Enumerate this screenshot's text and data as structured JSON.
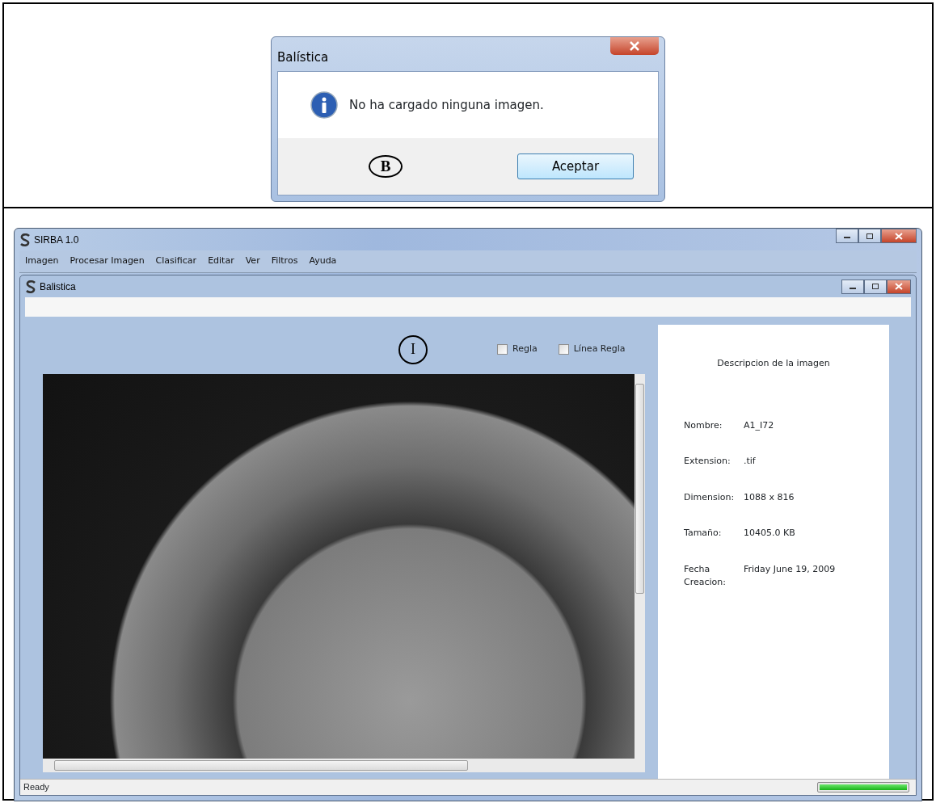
{
  "dialog": {
    "title": "Balística",
    "message": "No ha cargado ninguna imagen.",
    "annotation": "B",
    "buttons": [
      {
        "label": "Aceptar",
        "selected": true
      }
    ]
  },
  "window": {
    "title": "SIRBA 1.0"
  },
  "menu": [
    "Imagen",
    "Procesar Imagen",
    "Clasificar",
    "Editar",
    "Ver",
    "Filtros",
    "Ayuda"
  ],
  "child_window": {
    "title": "Balistica"
  },
  "annotation": "I",
  "options": [
    {
      "label": "Regla",
      "checked": false
    },
    {
      "label": "Línea Regla",
      "checked": false
    }
  ],
  "description": {
    "title": "Descripcion de la imagen",
    "fields": [
      {
        "label": "Nombre:",
        "value": "A1_I72"
      },
      {
        "label": "Extension:",
        "value": ".tif"
      },
      {
        "label": "Dimension:",
        "value": "1088 x 816"
      },
      {
        "label": "Tamaño:",
        "value": "10405.0 KB"
      },
      {
        "label": "Fecha Creacion:",
        "value": "Friday June 19, 2009"
      }
    ]
  },
  "status_bar": {
    "text": "Ready",
    "progress": {
      "level": 1
    }
  }
}
